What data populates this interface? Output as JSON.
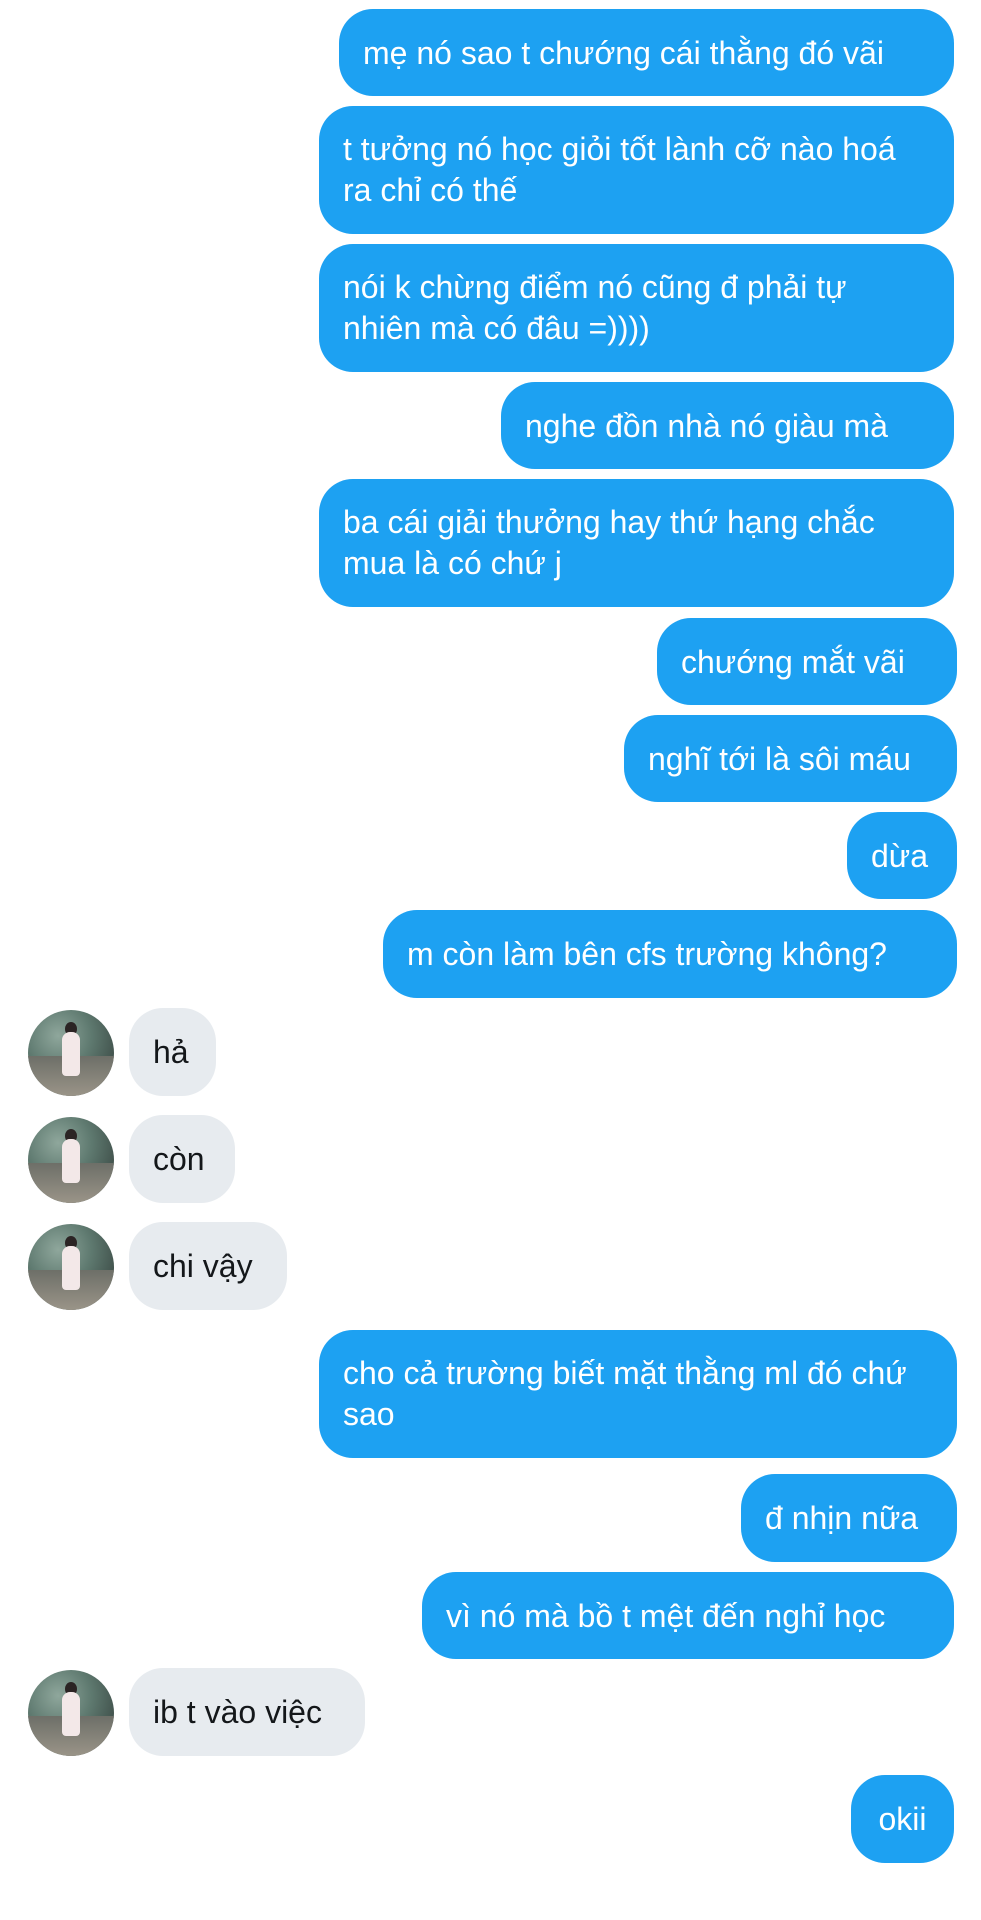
{
  "conversation": {
    "messages": [
      {
        "dir": "out",
        "text": "mẹ nó sao t chướng cái thằng đó vãi"
      },
      {
        "dir": "out",
        "text": "t tưởng nó học giỏi tốt lành cỡ nào hoá ra chỉ có thế"
      },
      {
        "dir": "out",
        "text": "nói k chừng điểm nó cũng đ phải tự nhiên mà có đâu =))))"
      },
      {
        "dir": "out",
        "text": "nghe đồn nhà nó giàu mà"
      },
      {
        "dir": "out",
        "text": "ba cái giải thưởng hay thứ hạng chắc mua là có chứ j"
      },
      {
        "dir": "out",
        "text": "chướng mắt vãi"
      },
      {
        "dir": "out",
        "text": "nghĩ tới là sôi máu"
      },
      {
        "dir": "out",
        "text": "dừa"
      },
      {
        "dir": "out",
        "text": "m còn làm bên cfs trường không?"
      },
      {
        "dir": "in",
        "text": "hả"
      },
      {
        "dir": "in",
        "text": "còn"
      },
      {
        "dir": "in",
        "text": "chi vậy"
      },
      {
        "dir": "out",
        "text": "cho cả trường biết mặt thằng ml đó chứ sao"
      },
      {
        "dir": "out",
        "text": "đ nhịn nữa"
      },
      {
        "dir": "out",
        "text": "vì nó mà bồ t mệt đến nghỉ học"
      },
      {
        "dir": "in",
        "text": "ib t vào việc"
      },
      {
        "dir": "out",
        "text": "okii"
      }
    ]
  },
  "theme": {
    "outgoing_bubble_color": "#1da1f2",
    "incoming_bubble_color": "#e7ebef",
    "outgoing_text_color": "#ffffff",
    "incoming_text_color": "#14171a"
  },
  "avatar": {
    "icon": "contact-avatar-photo"
  }
}
